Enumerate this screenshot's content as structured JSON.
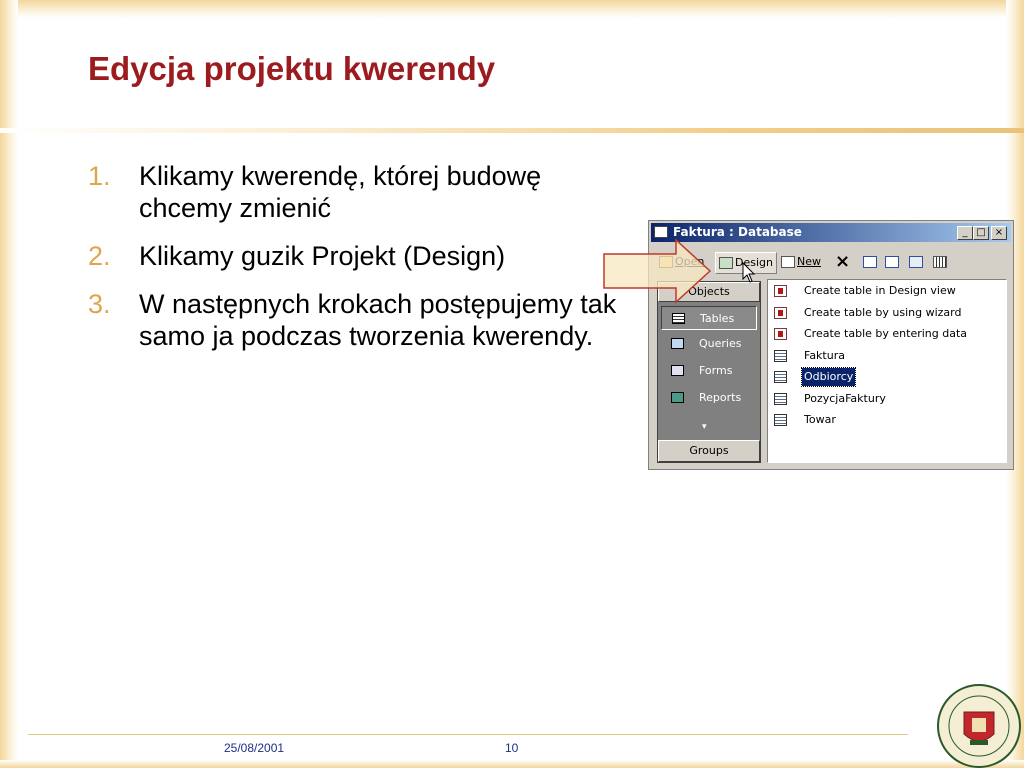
{
  "slide": {
    "title": "Edycja projektu kwerendy",
    "bullets": [
      {
        "num": "1.",
        "text": "Klikamy kwerendę, której budowę chcemy zmienić"
      },
      {
        "num": "2.",
        "text": "Klikamy guzik Projekt (Design)"
      },
      {
        "num": "3.",
        "text": "W następnych krokach postępujemy tak samo ja podczas tworzenia kwerendy."
      }
    ],
    "footer": {
      "date": "25/08/2001",
      "page": "10"
    },
    "colors": {
      "title": "#9b1b1e",
      "accent": "#e0a54a",
      "footer_text": "#1d2f8a"
    }
  },
  "window": {
    "title": "Faktura : Database",
    "controls": {
      "minimize": "_",
      "maximize": "□",
      "close": "×"
    },
    "toolbar": {
      "open": "Open",
      "design": "Design",
      "new": "New",
      "delete_icon": "×"
    },
    "objects": {
      "header": "Objects",
      "items": [
        "Tables",
        "Queries",
        "Forms",
        "Reports"
      ],
      "selected": "Tables",
      "more": "▾",
      "groups": "Groups"
    },
    "list": [
      {
        "label": "Create table in Design view",
        "icon": "wizard-icon"
      },
      {
        "label": "Create table by using wizard",
        "icon": "wizard-icon"
      },
      {
        "label": "Create table by entering data",
        "icon": "wizard-icon"
      },
      {
        "label": "Faktura",
        "icon": "table-icon"
      },
      {
        "label": "Odbiorcy",
        "icon": "table-icon",
        "selected": true
      },
      {
        "label": "PozycjaFaktury",
        "icon": "table-icon"
      },
      {
        "label": "Towar",
        "icon": "table-icon"
      }
    ]
  }
}
